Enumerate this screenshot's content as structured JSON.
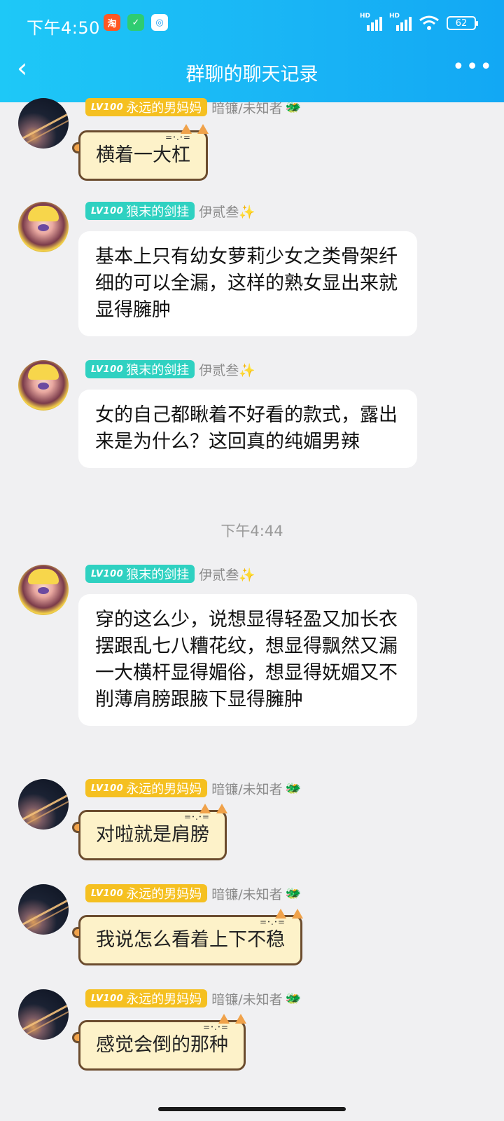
{
  "status_bar": {
    "time": "下午4:50",
    "battery": "62",
    "hd1": "HD",
    "hd2": "HD",
    "app_icons": [
      "taobao-icon",
      "shield-icon",
      "cloud-icon"
    ]
  },
  "header": {
    "title": "群聊的聊天记录",
    "back_icon": "‹",
    "more_icon": "•••"
  },
  "colors": {
    "header_blue": "#19b4f5",
    "badge_yellow": "#f5c021",
    "badge_teal": "#2fd1c1"
  },
  "messages": [
    {
      "lv": "LV100",
      "badge": "永远的男妈妈",
      "nick": "暗镰/未知者",
      "flag": "🐲",
      "text": "横着一大杠"
    },
    {
      "lv": "LV100",
      "badge": "狼末的剑挂",
      "nick": "伊贰叁✨",
      "text": "基本上只有幼女萝莉少女之类骨架纤细的可以全漏，这样的熟女显出来就显得臃肿"
    },
    {
      "lv": "LV100",
      "badge": "狼末的剑挂",
      "nick": "伊贰叁✨",
      "text": "女的自己都瞅着不好看的款式，露出来是为什么？这回真的纯媚男辣"
    },
    {
      "lv": "LV100",
      "badge": "狼末的剑挂",
      "nick": "伊贰叁✨",
      "text": "穿的这么少，说想显得轻盈又加长衣摆跟乱七八糟花纹，想显得飘然又漏一大横杆显得媚俗，想显得妩媚又不削薄肩膀跟腋下显得臃肿"
    },
    {
      "lv": "LV100",
      "badge": "永远的男妈妈",
      "nick": "暗镰/未知者",
      "flag": "🐲",
      "text": "对啦就是肩膀"
    },
    {
      "lv": "LV100",
      "badge": "永远的男妈妈",
      "nick": "暗镰/未知者",
      "flag": "🐲",
      "text": "我说怎么看着上下不稳"
    },
    {
      "lv": "LV100",
      "badge": "永远的男妈妈",
      "nick": "暗镰/未知者",
      "flag": "🐲",
      "text": "感觉会倒的那种"
    }
  ],
  "time_separator": "下午4:44"
}
